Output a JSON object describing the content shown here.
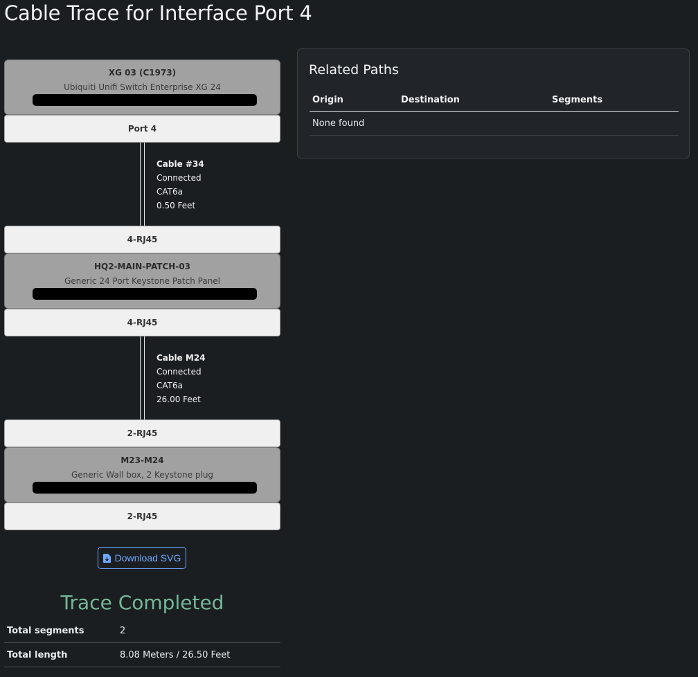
{
  "page": {
    "title": "Cable Trace for Interface Port 4"
  },
  "trace": {
    "hops": [
      {
        "device": {
          "name": "XG 03 (C1973)",
          "type": "Ubiquiti Unifi Switch Enterprise XG 24"
        },
        "near_port": "Port 4",
        "cable": {
          "name": "Cable #34",
          "status": "Connected",
          "type": "CAT6a",
          "length": "0.50 Feet"
        },
        "far_port": "4-RJ45"
      },
      {
        "device": {
          "name": "HQ2-MAIN-PATCH-03",
          "type": "Generic 24 Port Keystone Patch Panel"
        },
        "near_port": "4-RJ45",
        "cable": {
          "name": "Cable M24",
          "status": "Connected",
          "type": "CAT6a",
          "length": "26.00 Feet"
        },
        "far_port": "2-RJ45"
      },
      {
        "device": {
          "name": "M23-M24",
          "type": "Generic Wall box, 2 Keystone plug"
        },
        "near_port": "2-RJ45"
      }
    ],
    "download_label": "Download SVG",
    "status": "Trace Completed",
    "summary": [
      {
        "label": "Total segments",
        "value": "2"
      },
      {
        "label": "Total length",
        "value": "8.08 Meters / 26.50 Feet"
      }
    ]
  },
  "related_paths": {
    "title": "Related Paths",
    "columns": [
      "Origin",
      "Destination",
      "Segments"
    ],
    "empty_text": "None found"
  },
  "colors": {
    "accent": "#6ea8fe",
    "success": "#75b798",
    "background": "#1b1e21"
  }
}
